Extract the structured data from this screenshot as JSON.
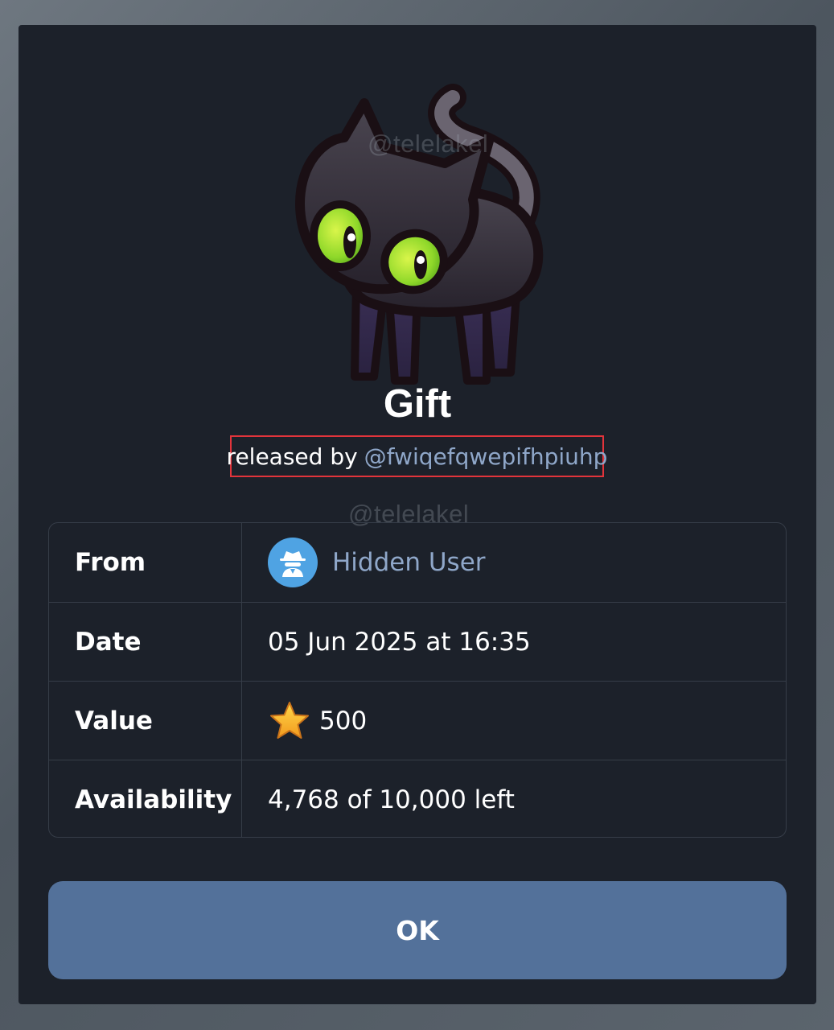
{
  "dialog": {
    "title": "Gift",
    "released_prefix": "released by",
    "released_by": "@fwiqefqwepifhpiuhp",
    "watermark": "@telelakel",
    "art": "black-cat-gift-icon"
  },
  "details": {
    "from_label": "From",
    "from_value": "Hidden User",
    "from_avatar_icon": "hidden-user-spy-icon",
    "date_label": "Date",
    "date_value": "05 Jun 2025 at 16:35",
    "value_label": "Value",
    "value_icon": "star-icon",
    "value_amount": "500",
    "availability_label": "Availability",
    "availability_value": "4,768 of 10,000 left"
  },
  "actions": {
    "ok_label": "OK"
  },
  "colors": {
    "panel_background": "#1c212a",
    "link": "#8fa7c9",
    "button": "#53719a",
    "highlight_box": "#e2343b",
    "avatar": "#4fa3e3",
    "cat_eye": "#9be22a"
  }
}
